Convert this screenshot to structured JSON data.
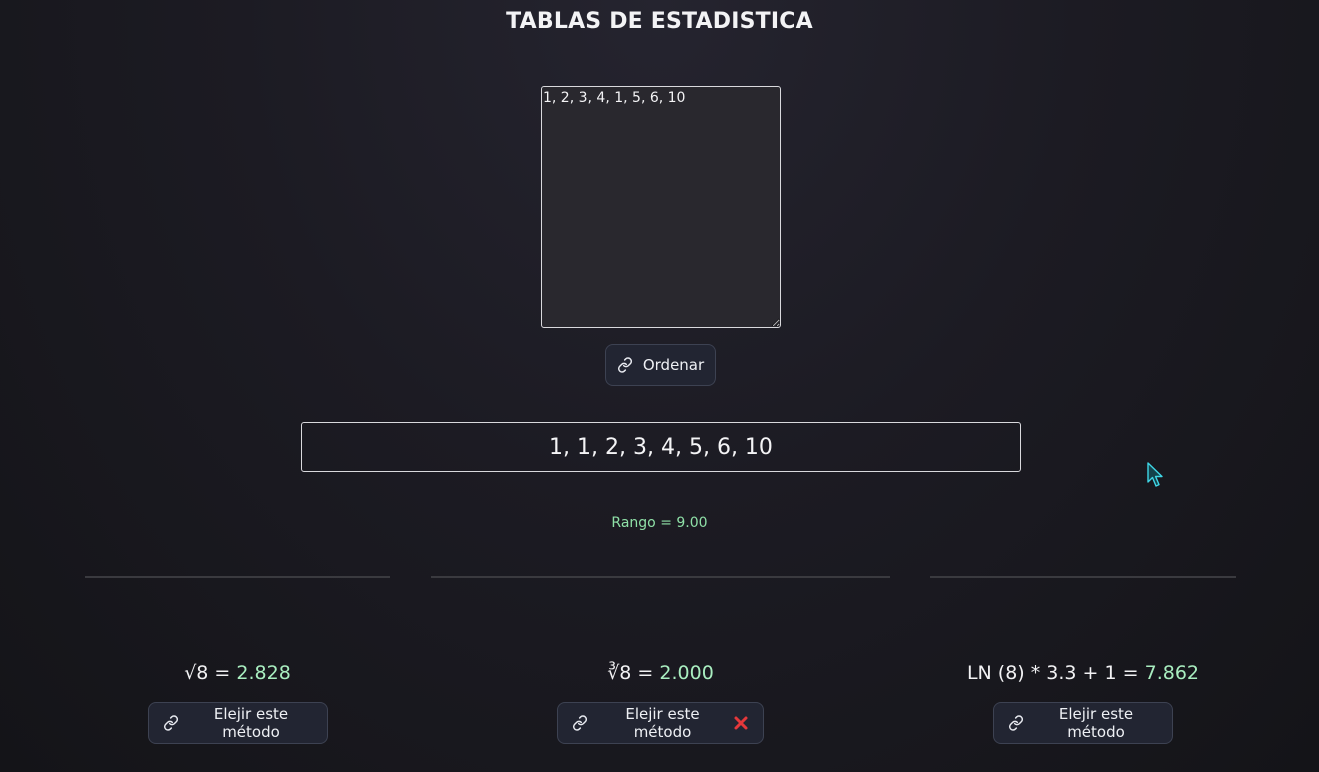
{
  "header": {
    "title": "TABLAS DE ESTADISTICA"
  },
  "input": {
    "value": "1, 2, 3, 4, 1, 5, 6, 10"
  },
  "sort_button": {
    "label": "Ordenar",
    "icon": "link-icon"
  },
  "sorted": {
    "text": "1, 1, 2, 3, 4, 5, 6, 10"
  },
  "range": {
    "text": "Rango = 9.00"
  },
  "methods": [
    {
      "formula": "√8 = ",
      "value": "2.828",
      "button_label": "Elejir este método",
      "icon": "link-icon"
    },
    {
      "formula": "∛8 = ",
      "value": "2.000",
      "button_label": "Elejir este método",
      "icon": "link-icon",
      "status_icon": "cross-mark-icon"
    },
    {
      "formula": "LN (8) * 3.3 + 1 = ",
      "value": "7.862",
      "button_label": "Elejir este método",
      "icon": "link-icon"
    }
  ],
  "colors": {
    "accent_green": "#8fe0a7",
    "value_green": "#a9eec0",
    "button_bg": "#222532",
    "cross_red": "#e5383b"
  }
}
